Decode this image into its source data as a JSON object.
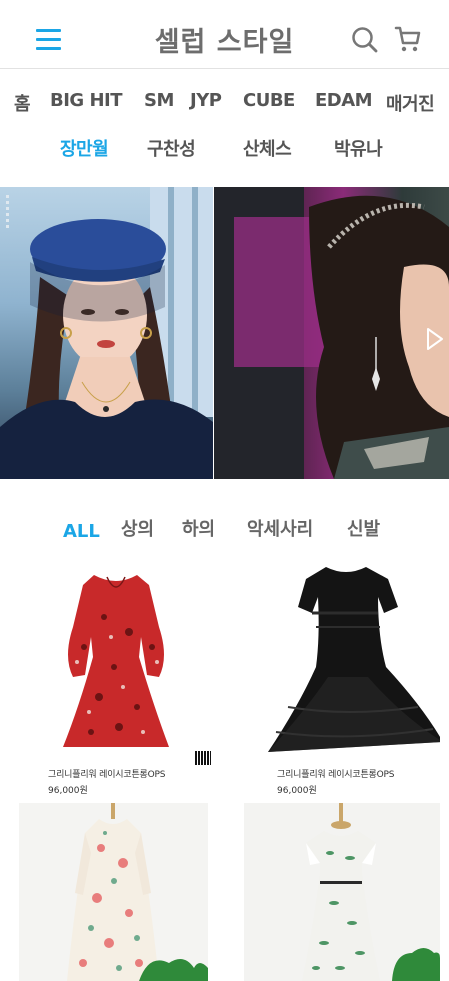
{
  "header": {
    "title": "셀럽 스타일"
  },
  "nav": {
    "items": [
      {
        "label": "홈"
      },
      {
        "label": "BIG HIT"
      },
      {
        "label": "SM"
      },
      {
        "label": "JYP"
      },
      {
        "label": "CUBE"
      },
      {
        "label": "EDAM"
      },
      {
        "label": "매거진"
      },
      {
        "label": "장만월"
      },
      {
        "label": "구찬성"
      },
      {
        "label": "산체스"
      },
      {
        "label": "박유나"
      }
    ],
    "active": "장만월"
  },
  "tabs": {
    "items": [
      {
        "label": "ALL"
      },
      {
        "label": "상의"
      },
      {
        "label": "하의"
      },
      {
        "label": "악세사리"
      },
      {
        "label": "신발"
      }
    ],
    "active": "ALL"
  },
  "products": [
    {
      "name": "그리니플리워 레이시코튼롱OPS",
      "price": "96,000원"
    },
    {
      "name": "그리니플리워 레이시코튼롱OPS",
      "price": "96,000원"
    },
    {
      "name": "",
      "price": ""
    },
    {
      "name": "",
      "price": ""
    }
  ],
  "colors": {
    "accent": "#1ba6e6",
    "title": "#6d6d6d"
  }
}
